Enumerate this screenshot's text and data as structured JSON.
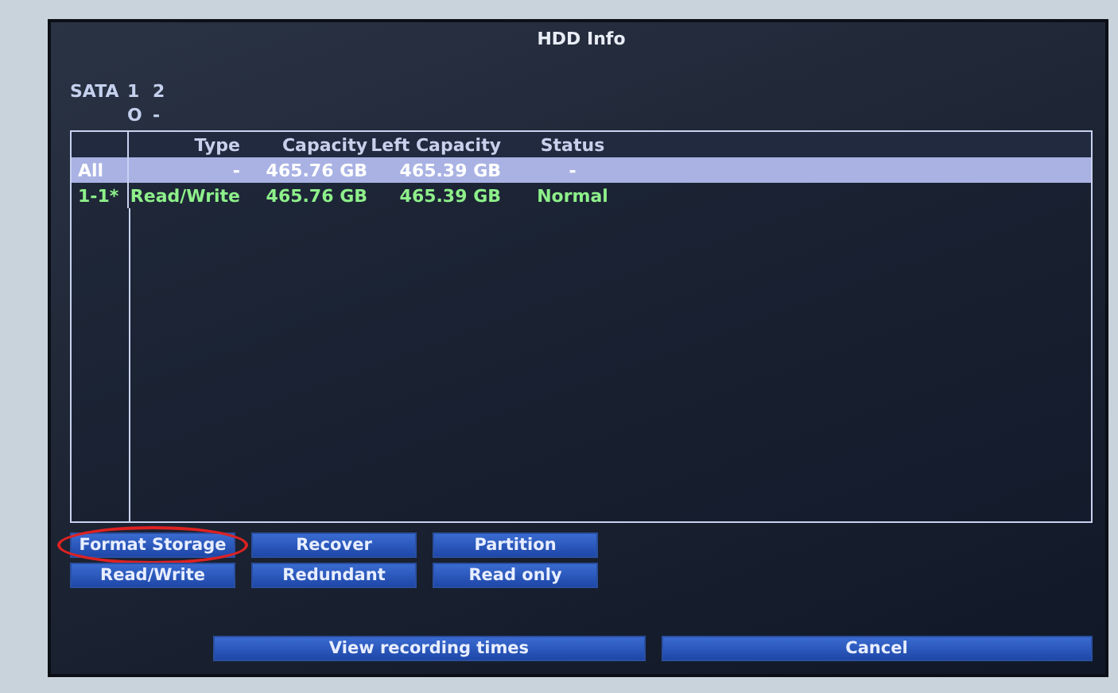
{
  "window": {
    "title": "HDD Info"
  },
  "sata": {
    "label": "SATA",
    "ports": [
      {
        "number": "1",
        "status": "O"
      },
      {
        "number": "2",
        "status": "-"
      }
    ]
  },
  "table": {
    "columns": [
      "",
      "Type",
      "Capacity",
      "Left Capacity",
      "Status"
    ],
    "rows": [
      {
        "cells": [
          "All",
          "-",
          "465.76 GB",
          "465.39 GB",
          "-"
        ],
        "selected": true
      },
      {
        "cells": [
          "1-1*",
          "Read/Write",
          "465.76 GB",
          "465.39 GB",
          "Normal"
        ],
        "selected": false
      }
    ]
  },
  "actions": [
    {
      "label": "Format Storage",
      "circled": true
    },
    {
      "label": "Recover",
      "circled": false
    },
    {
      "label": "Partition",
      "circled": false
    },
    {
      "label": "Read/Write",
      "circled": false
    },
    {
      "label": "Redundant",
      "circled": false
    },
    {
      "label": "Read only",
      "circled": false
    }
  ],
  "footer_buttons": [
    "View recording times",
    "Cancel"
  ]
}
